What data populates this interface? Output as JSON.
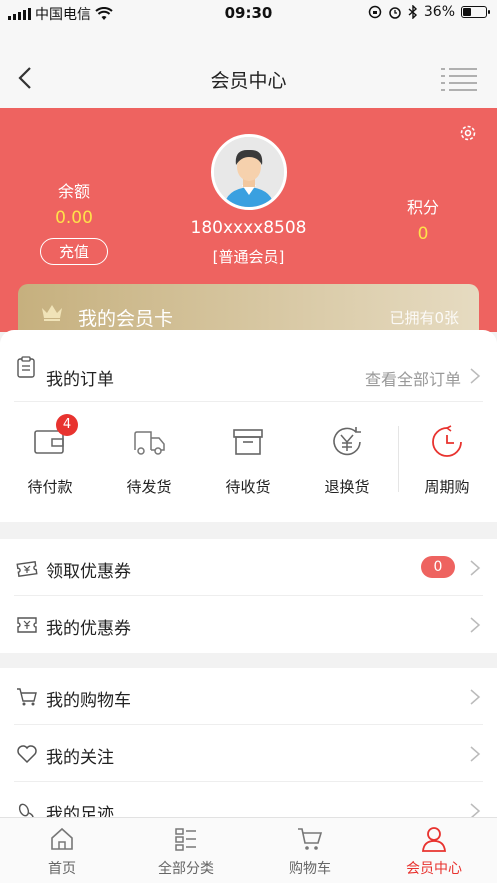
{
  "status_bar": {
    "carrier": "中国电信",
    "time": "09:30",
    "battery": "36%",
    "battery_level": 0.36
  },
  "nav": {
    "title": "会员中心"
  },
  "profile": {
    "balance_label": "余额",
    "balance_value": "0.00",
    "recharge_label": "充值",
    "phone": "180xxxx8508",
    "level": "[普通会员]",
    "points_label": "积分",
    "points_value": "0"
  },
  "member_card": {
    "title": "我的会员卡",
    "owned": "已拥有0张"
  },
  "orders": {
    "title": "我的订单",
    "view_all": "查看全部订单",
    "items": [
      {
        "label": "待付款",
        "badge": "4"
      },
      {
        "label": "待发货"
      },
      {
        "label": "待收货"
      },
      {
        "label": "退换货"
      },
      {
        "label": "周期购"
      }
    ]
  },
  "coupons": {
    "items": [
      {
        "label": "领取优惠券",
        "count": "0"
      },
      {
        "label": "我的优惠券"
      }
    ]
  },
  "misc": {
    "items": [
      {
        "label": "我的购物车"
      },
      {
        "label": "我的关注"
      },
      {
        "label": "我的足迹"
      }
    ]
  },
  "tabbar": {
    "items": [
      {
        "label": "首页"
      },
      {
        "label": "全部分类"
      },
      {
        "label": "购物车"
      },
      {
        "label": "会员中心"
      }
    ],
    "active_color": "#e8332f"
  },
  "colors": {
    "header": "#ee6360",
    "accent_yellow": "#ffe14a",
    "badge": "#e8332f"
  }
}
